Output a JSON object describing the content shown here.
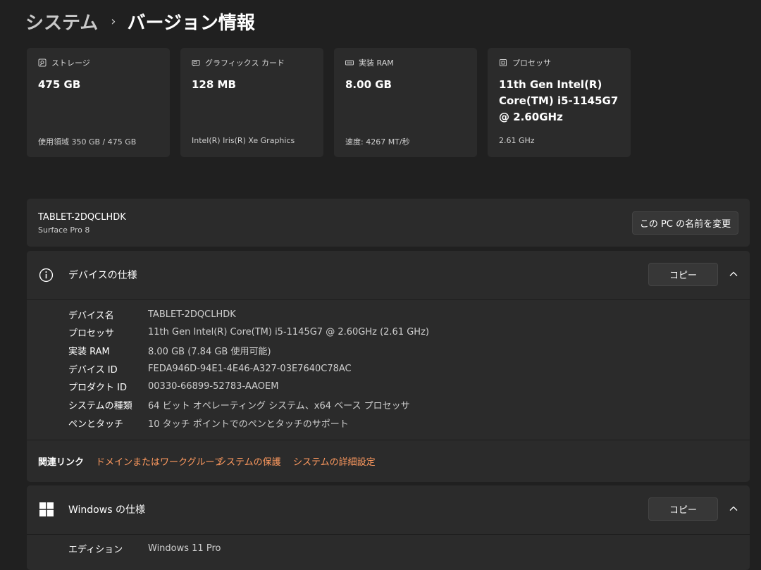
{
  "breadcrumb": {
    "parent": "システム",
    "separator": "›",
    "current": "バージョン情報"
  },
  "cards": [
    {
      "icon": "storage-icon",
      "title": "ストレージ",
      "value": "475 GB",
      "sub": "使用領域 350 GB / 475 GB"
    },
    {
      "icon": "graphics-card-icon",
      "title": "グラフィックス カード",
      "value": "128 MB",
      "sub": "Intel(R) Iris(R) Xe Graphics"
    },
    {
      "icon": "ram-icon",
      "title": "実装 RAM",
      "value": "8.00 GB",
      "sub": "速度: 4267 MT/秒"
    },
    {
      "icon": "processor-icon",
      "title": "プロセッサ",
      "value": "11th Gen Intel(R) Core(TM) i5-1145G7 @ 2.60GHz",
      "sub": "2.61 GHz"
    }
  ],
  "pc": {
    "name": "TABLET-2DQCLHDK",
    "model": "Surface Pro 8",
    "rename_label": "この PC の名前を変更"
  },
  "device_spec": {
    "icon": "info-icon",
    "title": "デバイスの仕様",
    "copy_label": "コピー",
    "rows": [
      {
        "label": "デバイス名",
        "value": "TABLET-2DQCLHDK"
      },
      {
        "label": "プロセッサ",
        "value": "11th Gen Intel(R) Core(TM) i5-1145G7 @ 2.60GHz (2.61 GHz)"
      },
      {
        "label": "実装 RAM",
        "value": "8.00 GB (7.84 GB 使用可能)"
      },
      {
        "label": "デバイス ID",
        "value": "FEDA946D-94E1-4E46-A327-03E7640C78AC"
      },
      {
        "label": "プロダクト ID",
        "value": "00330-66899-52783-AAOEM"
      },
      {
        "label": "システムの種類",
        "value": "64 ビット オペレーティング システム、x64 ベース プロセッサ"
      },
      {
        "label": "ペンとタッチ",
        "value": "10 タッチ ポイントでのペンとタッチのサポート"
      }
    ]
  },
  "related_links": {
    "label": "関連リンク",
    "links": [
      "ドメインまたはワークグループ",
      "システムの保護",
      "システムの詳細設定"
    ]
  },
  "windows_spec": {
    "icon": "windows-logo-icon",
    "title": "Windows の仕様",
    "copy_label": "コピー",
    "rows": [
      {
        "label": "エディション",
        "value": "Windows 11 Pro"
      }
    ]
  },
  "colors": {
    "background": "#202020",
    "card": "#2b2b2b",
    "link": "#ff9a5f"
  }
}
